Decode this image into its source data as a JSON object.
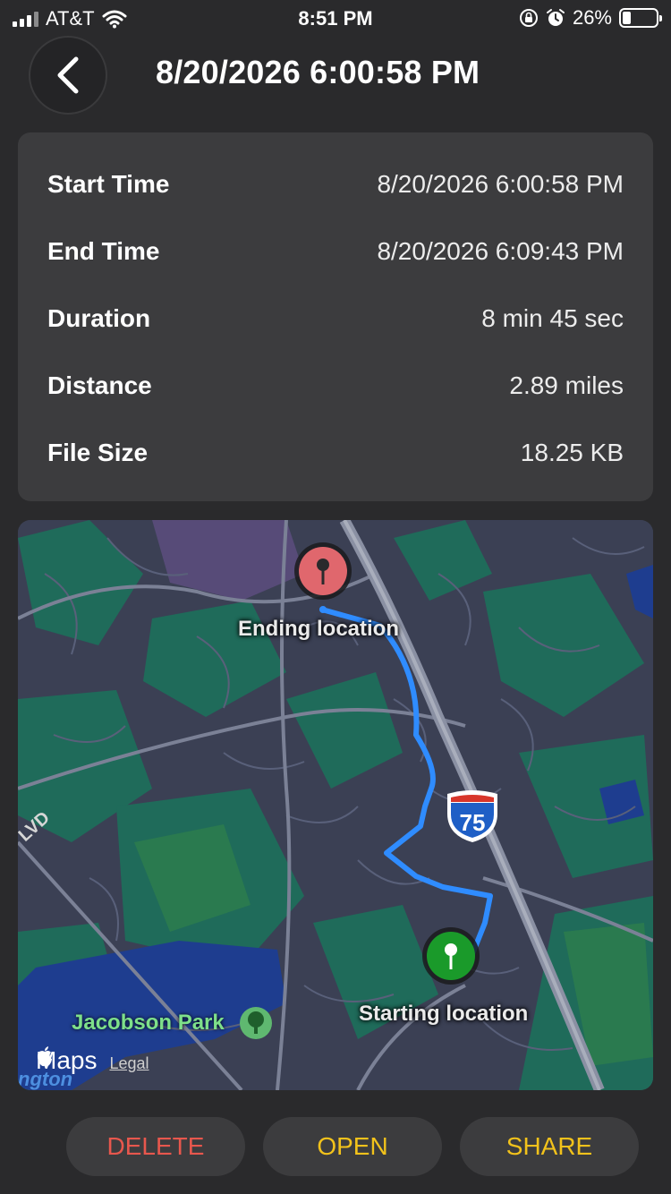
{
  "status_bar": {
    "carrier": "AT&T",
    "time": "8:51 PM",
    "battery_percent": "26%",
    "battery_level": 0.26,
    "icons": [
      "signal-icon",
      "wifi-icon",
      "orientation-lock-icon",
      "alarm-icon",
      "battery-icon"
    ]
  },
  "header": {
    "back_icon": "chevron-left-icon",
    "title": "8/20/2026 6:00:58 PM"
  },
  "details": [
    {
      "label": "Start Time",
      "value": "8/20/2026 6:00:58 PM"
    },
    {
      "label": "End Time",
      "value": "8/20/2026 6:09:43 PM"
    },
    {
      "label": "Duration",
      "value": "8 min 45 sec"
    },
    {
      "label": "Distance",
      "value": "2.89 miles"
    },
    {
      "label": "File Size",
      "value": "18.25 KB"
    }
  ],
  "map": {
    "end_label": "Ending location",
    "start_label": "Starting location",
    "park_label": "Jacobson Park",
    "highway_shield": "75",
    "road_label": "LVD",
    "town_label": "ngton",
    "attribution": "Maps",
    "legal": "Legal",
    "colors": {
      "route": "#2f8cff",
      "end_pin": "#e0676d",
      "start_pin": "#1a9a2a",
      "water": "#1e3d8f",
      "greenery": "#1f6b5a",
      "park_text": "#7ee08a"
    }
  },
  "actions": {
    "delete": "DELETE",
    "open": "OPEN",
    "share": "SHARE"
  },
  "colors": {
    "background": "#2a2a2c",
    "card": "#3c3c3e",
    "delete": "#e8574d",
    "accent": "#f2c21b"
  }
}
